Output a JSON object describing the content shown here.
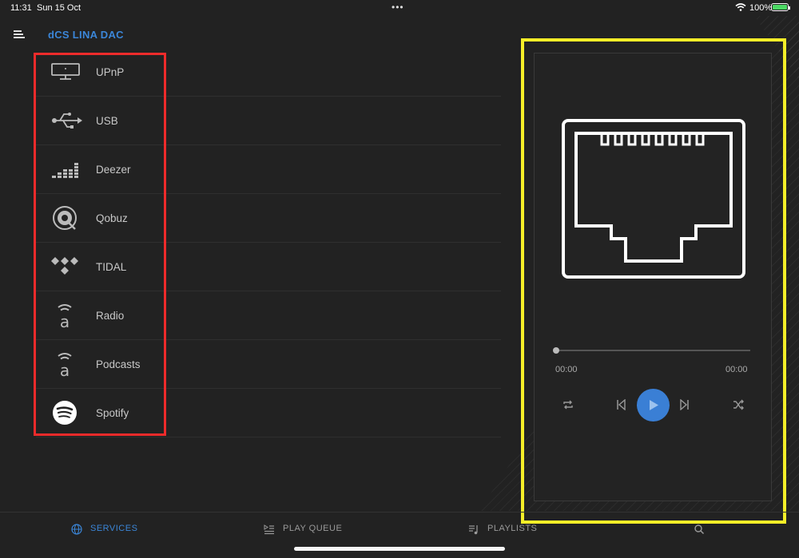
{
  "status_bar": {
    "time": "11:31",
    "date": "Sun 15 Oct",
    "battery_percent": "100%",
    "battery_level": 1.0
  },
  "header": {
    "title": "dCS LINA DAC"
  },
  "services": [
    {
      "label": "UPnP",
      "icon": "upnp-monitor-icon"
    },
    {
      "label": "USB",
      "icon": "usb-icon"
    },
    {
      "label": "Deezer",
      "icon": "deezer-icon"
    },
    {
      "label": "Qobuz",
      "icon": "qobuz-icon"
    },
    {
      "label": "TIDAL",
      "icon": "tidal-icon"
    },
    {
      "label": "Radio",
      "icon": "radio-icon"
    },
    {
      "label": "Podcasts",
      "icon": "podcasts-icon"
    },
    {
      "label": "Spotify",
      "icon": "spotify-icon"
    }
  ],
  "player": {
    "artwork_icon": "ethernet-port-icon",
    "elapsed": "00:00",
    "duration": "00:00",
    "progress": 0.0
  },
  "tabs": [
    {
      "label": "SERVICES",
      "icon": "globe-icon",
      "active": true
    },
    {
      "label": "PLAY QUEUE",
      "icon": "play-queue-icon",
      "active": false
    },
    {
      "label": "PLAYLISTS",
      "icon": "playlists-icon",
      "active": false
    },
    {
      "label": "",
      "icon": "search-icon",
      "active": false
    }
  ],
  "colors": {
    "accent": "#3b86d8",
    "background": "#222222",
    "highlight_red": "#ee2b2b",
    "highlight_yellow": "#f5ee28"
  }
}
